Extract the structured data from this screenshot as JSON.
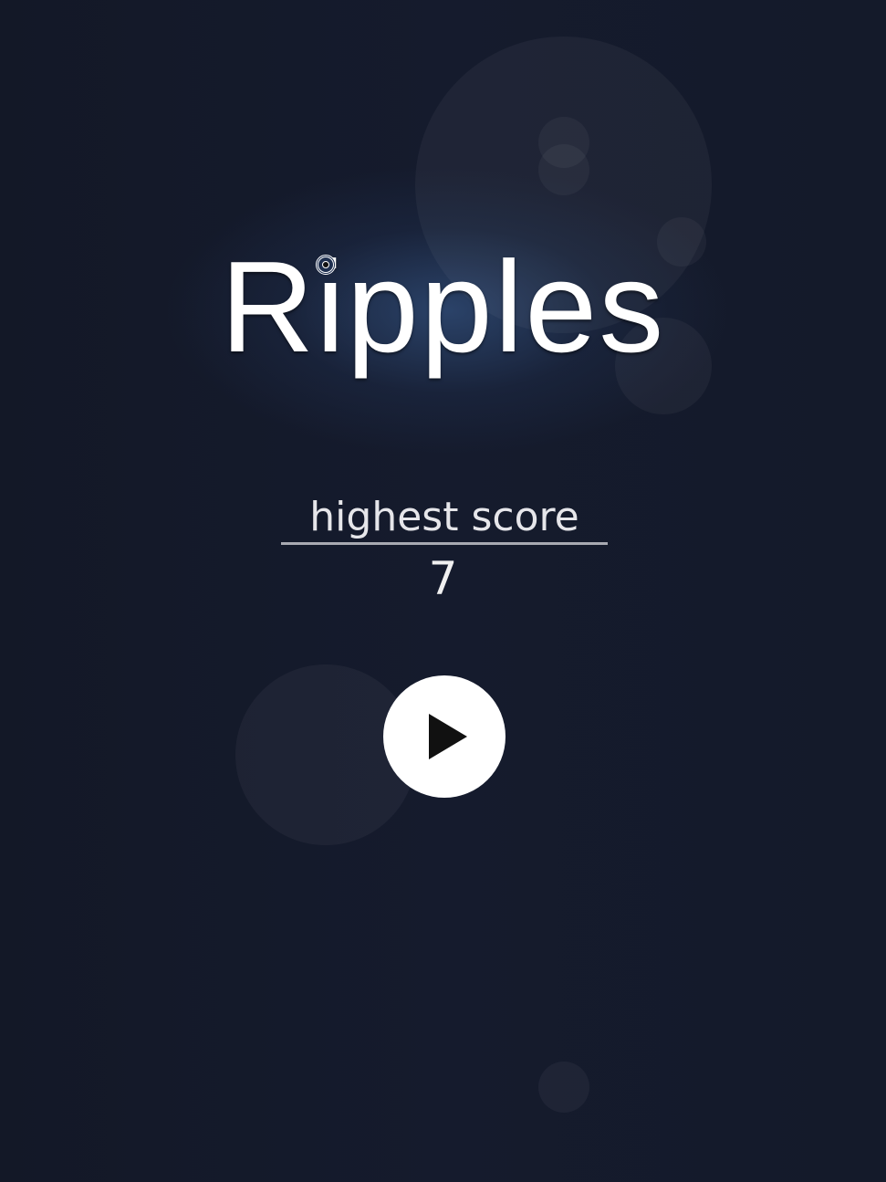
{
  "title": "Ripples",
  "highest_score": {
    "label": "highest score",
    "value": "7"
  },
  "play_button": {
    "icon": "play-icon"
  },
  "colors": {
    "background": "#141a2b",
    "text": "#ffffff"
  }
}
